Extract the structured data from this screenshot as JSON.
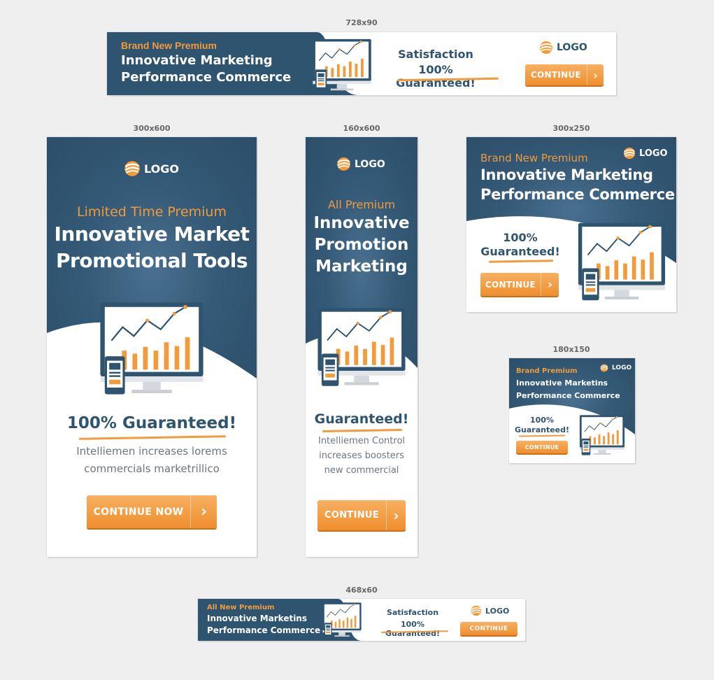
{
  "sizes": {
    "b728": "728x90",
    "b300x600": "300x600",
    "b160": "160x600",
    "b300x250": "300x250",
    "b180": "180x150",
    "b468": "468x60"
  },
  "logo_text": "LOGO",
  "colors": {
    "navy": "#2f5470",
    "orange": "#f39a3a",
    "background": "#efefef"
  },
  "icons": {
    "logo": "swirl-logo-icon",
    "arrow": "chevron-right-icon",
    "chart": "monitor-bar-chart-icon"
  },
  "b728": {
    "eyebrow": "Brand New Premium",
    "title1": "Innovative Marketing",
    "title2": "Performance Commerce",
    "tag1": "Satisfaction",
    "tag2": "100% Guaranteed!",
    "button": "CONTINUE",
    "arrow": "›"
  },
  "b300x600": {
    "eyebrow": "Limited Time Premium",
    "title1": "Innovative Market",
    "title2": "Promotional Tools",
    "guarantee": "100% Guaranteed!",
    "body1": "Intelliemen increases lorems",
    "body2": "commercials marketrillico",
    "button": "CONTINUE NOW",
    "arrow": "›"
  },
  "b160": {
    "eyebrow": "All Premium",
    "title1": "Innovative",
    "title2": "Promotion",
    "title3": "Marketing",
    "guarantee": "Guaranteed!",
    "body1": "Intelliemen Control",
    "body2": "increases boosters",
    "body3": "new commercial",
    "button": "CONTINUE",
    "arrow": "›"
  },
  "b300x250": {
    "eyebrow": "Brand New Premium",
    "title1": "Innovative Marketing",
    "title2": "Performance Commerce",
    "guarantee1": "100%",
    "guarantee2": "Guaranteed!",
    "button": "CONTINUE",
    "arrow": "›"
  },
  "b180": {
    "eyebrow": "Brand Premium",
    "title1": "Innovative Marketins",
    "title2": "Performance Commerce",
    "guarantee1": "100%",
    "guarantee2": "Guaranteed!",
    "button": "CONTINUE"
  },
  "b468": {
    "eyebrow": "All New Premium",
    "title1": "Innovative Marketins",
    "title2": "Performance Commerce",
    "tag1": "Satisfaction",
    "tag2": "100% Guaranteed!",
    "button": "CONTINUE"
  }
}
